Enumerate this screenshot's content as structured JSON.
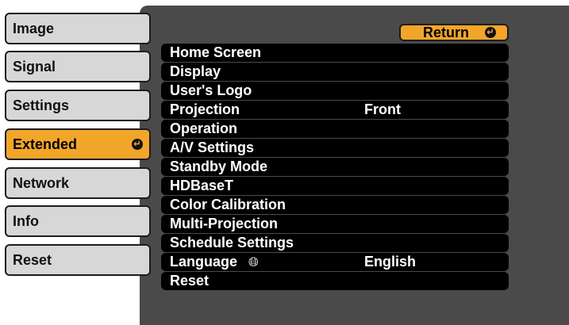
{
  "tabs": [
    {
      "label": "Image"
    },
    {
      "label": "Signal"
    },
    {
      "label": "Settings"
    },
    {
      "label": "Extended",
      "selected": true
    },
    {
      "label": "Network"
    },
    {
      "label": "Info"
    },
    {
      "label": "Reset"
    }
  ],
  "return_label": "Return",
  "menu": [
    {
      "label": "Home Screen",
      "value": ""
    },
    {
      "label": "Display",
      "value": ""
    },
    {
      "label": "User's Logo",
      "value": ""
    },
    {
      "label": "Projection",
      "value": "Front"
    },
    {
      "label": "Operation",
      "value": ""
    },
    {
      "label": "A/V Settings",
      "value": ""
    },
    {
      "label": "Standby Mode",
      "value": ""
    },
    {
      "label": "HDBaseT",
      "value": ""
    },
    {
      "label": "Color Calibration",
      "value": ""
    },
    {
      "label": "Multi-Projection",
      "value": ""
    },
    {
      "label": "Schedule Settings",
      "value": ""
    },
    {
      "label": "Language",
      "value": "English"
    },
    {
      "label": "Reset",
      "value": ""
    }
  ],
  "icons": {
    "enter": "enter-icon",
    "globe": "globe-icon"
  },
  "colors": {
    "accent": "#f2a629",
    "tab_bg": "#d7d7d7",
    "panel_bg": "#4a4a4a",
    "item_bg": "#000000"
  }
}
